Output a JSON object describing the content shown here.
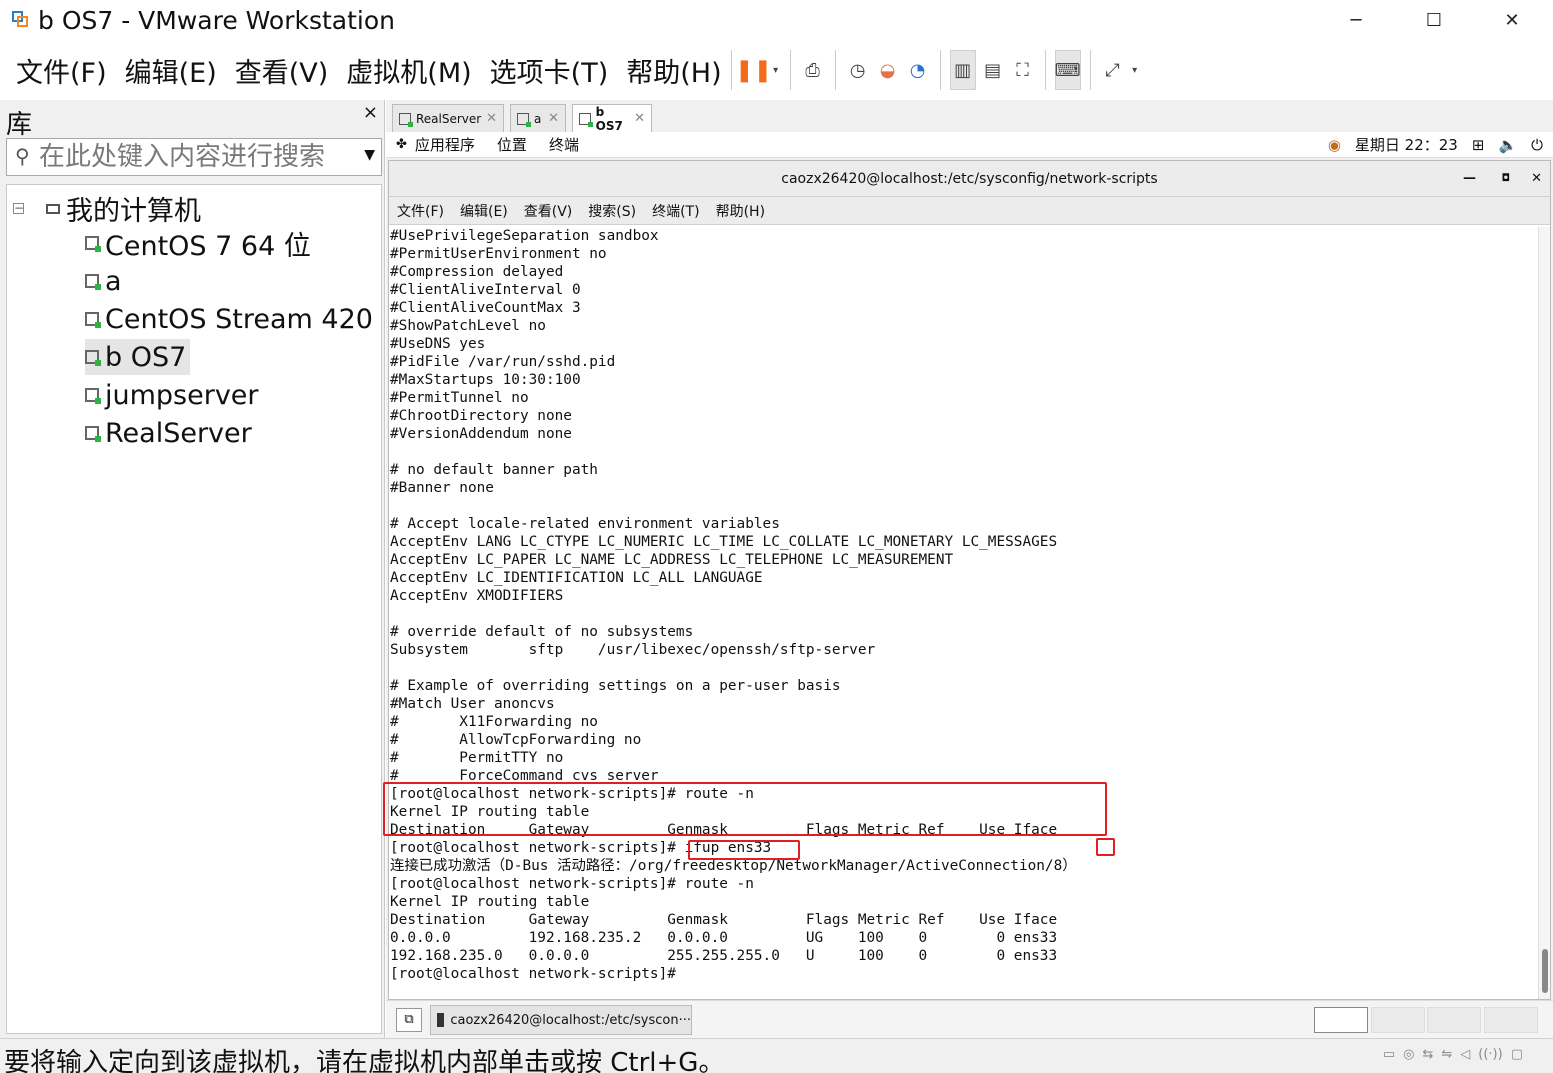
{
  "window": {
    "title": "b OS7 - VMware Workstation",
    "minimize": "─",
    "maximize": "☐",
    "close": "✕"
  },
  "menubar": {
    "items": [
      "文件(F)",
      "编辑(E)",
      "查看(V)",
      "虚拟机(M)",
      "选项卡(T)",
      "帮助(H)"
    ]
  },
  "library": {
    "title": "库",
    "close": "×",
    "search_placeholder": "在此处键入内容进行搜索",
    "root": "我的计算机",
    "vms": [
      "CentOS 7 64 位",
      "a",
      "CentOS Stream 420",
      "b OS7",
      "jumpserver",
      "RealServer"
    ],
    "selected_vm": "b OS7"
  },
  "tabs": [
    {
      "label": "RealServer"
    },
    {
      "label": "a"
    },
    {
      "label": "b OS7",
      "selected": true
    }
  ],
  "guest_panel": {
    "menus": [
      "应用程序",
      "位置",
      "终端"
    ],
    "clock": "星期日 22：23"
  },
  "terminal": {
    "title": "caozx26420@localhost:/etc/sysconfig/network-scripts",
    "menus": [
      "文件(F)",
      "编辑(E)",
      "查看(V)",
      "搜索(S)",
      "终端(T)",
      "帮助(H)"
    ],
    "lines": [
      "#UsePrivilegeSeparation sandbox",
      "#PermitUserEnvironment no",
      "#Compression delayed",
      "#ClientAliveInterval 0",
      "#ClientAliveCountMax 3",
      "#ShowPatchLevel no",
      "#UseDNS yes",
      "#PidFile /var/run/sshd.pid",
      "#MaxStartups 10:30:100",
      "#PermitTunnel no",
      "#ChrootDirectory none",
      "#VersionAddendum none",
      "",
      "# no default banner path",
      "#Banner none",
      "",
      "# Accept locale-related environment variables",
      "AcceptEnv LANG LC_CTYPE LC_NUMERIC LC_TIME LC_COLLATE LC_MONETARY LC_MESSAGES",
      "AcceptEnv LC_PAPER LC_NAME LC_ADDRESS LC_TELEPHONE LC_MEASUREMENT",
      "AcceptEnv LC_IDENTIFICATION LC_ALL LANGUAGE",
      "AcceptEnv XMODIFIERS",
      "",
      "# override default of no subsystems",
      "Subsystem       sftp    /usr/libexec/openssh/sftp-server",
      "",
      "# Example of overriding settings on a per-user basis",
      "#Match User anoncvs",
      "#       X11Forwarding no",
      "#       AllowTcpForwarding no",
      "#       PermitTTY no",
      "#       ForceCommand cvs server",
      "[root@localhost network-scripts]# route -n",
      "Kernel IP routing table",
      "Destination     Gateway         Genmask         Flags Metric Ref    Use Iface",
      "[root@localhost network-scripts]# ifup ens33",
      "连接已成功激活（D-Bus 活动路径：/org/freedesktop/NetworkManager/ActiveConnection/8）",
      "[root@localhost network-scripts]# route -n",
      "Kernel IP routing table",
      "Destination     Gateway         Genmask         Flags Metric Ref    Use Iface",
      "0.0.0.0         192.168.235.2   0.0.0.0         UG    100    0        0 ens33",
      "192.168.235.0   0.0.0.0         255.255.255.0   U     100    0        0 ens33",
      "[root@localhost network-scripts]# "
    ]
  },
  "guest_taskbar": {
    "task_label": "caozx26420@localhost:/etc/syscon···"
  },
  "statusbar": {
    "message": "要将输入定向到该虚拟机，请在虚拟机内部单击或按 Ctrl+G。"
  },
  "colors": {
    "highlight_box": "#e02020",
    "pause_accent": "#f26b1d"
  }
}
